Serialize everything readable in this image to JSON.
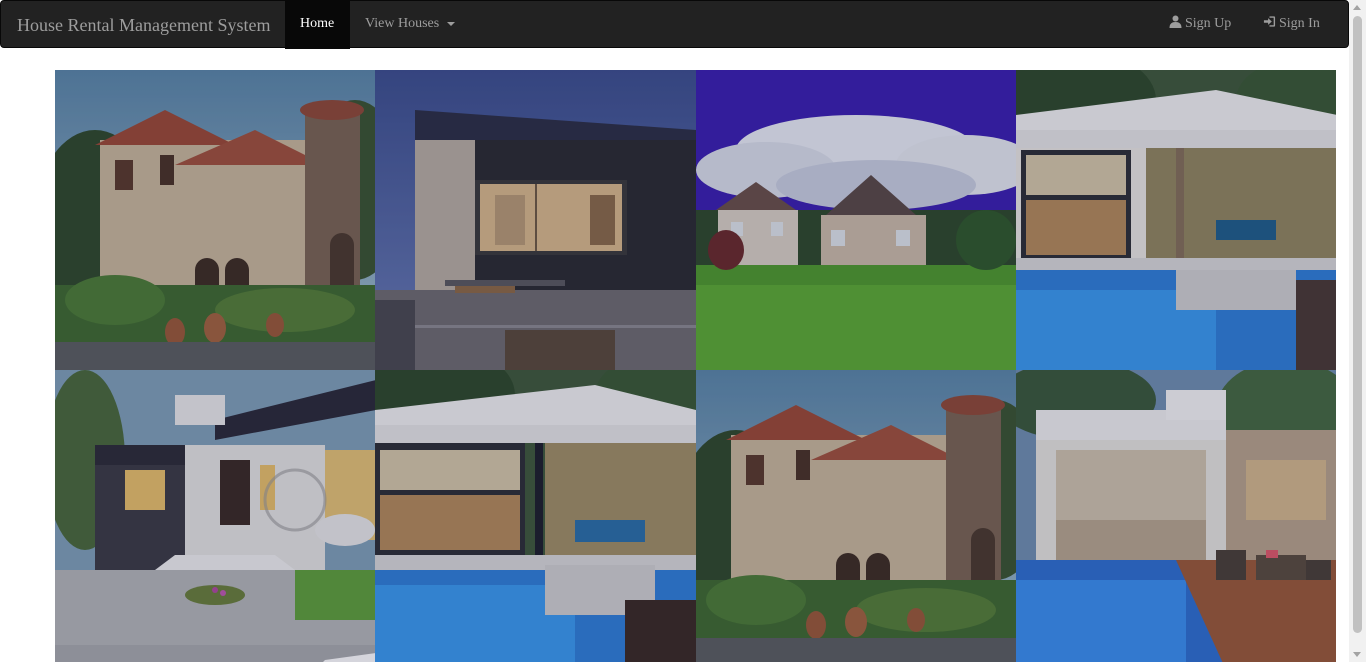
{
  "navbar": {
    "brand": "House Rental Management System",
    "items": [
      {
        "label": "Home",
        "active": true
      },
      {
        "label": "View Houses",
        "dropdown": true
      }
    ],
    "right": [
      {
        "label": "Sign Up",
        "icon": "user-icon"
      },
      {
        "label": "Sign In",
        "icon": "sign-in-icon"
      }
    ]
  },
  "gallery": {
    "images": [
      {
        "subject": "mediterranean-villa-photo"
      },
      {
        "subject": "modern-dark-house-photo"
      },
      {
        "subject": "twin-brick-houses-photo"
      },
      {
        "subject": "modern-pool-house-photo"
      },
      {
        "subject": "modern-bungalow-photo"
      },
      {
        "subject": "modern-pool-house-photo"
      },
      {
        "subject": "mediterranean-villa-photo"
      },
      {
        "subject": "white-pool-house-photo"
      }
    ]
  },
  "colors": {
    "navbar_bg": "#222222",
    "nav_text": "#9d9d9d",
    "active_bg": "#080808",
    "active_text": "#ffffff"
  }
}
